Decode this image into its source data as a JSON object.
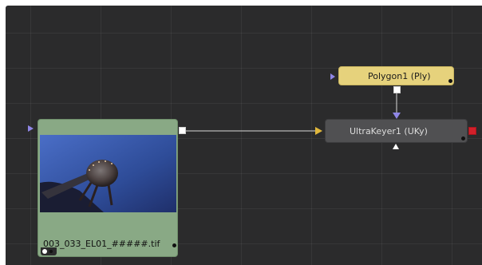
{
  "nodes": {
    "loader": {
      "label": "003_033_EL01_#####.tif"
    },
    "polygon": {
      "label": "Polygon1  (Ply)"
    },
    "ultrakeyer": {
      "label": "UltraKeyer1  (UKy)"
    }
  },
  "colors": {
    "canvas_bg": "#2b2b2c",
    "loader_node": "#89a985",
    "polygon_node": "#e6d27c",
    "ultrakeyer_node": "#505052",
    "input_pin_blue": "#8f86e6",
    "input_pin_yellow": "#e0b73c",
    "output_pin_red": "#d2202a",
    "wire": "#d8d8d8"
  },
  "icons": {
    "main_input": "triangle-right",
    "effect_mask_input": "triangle-down",
    "garbage_matte_input": "triangle-up",
    "output": "square"
  }
}
